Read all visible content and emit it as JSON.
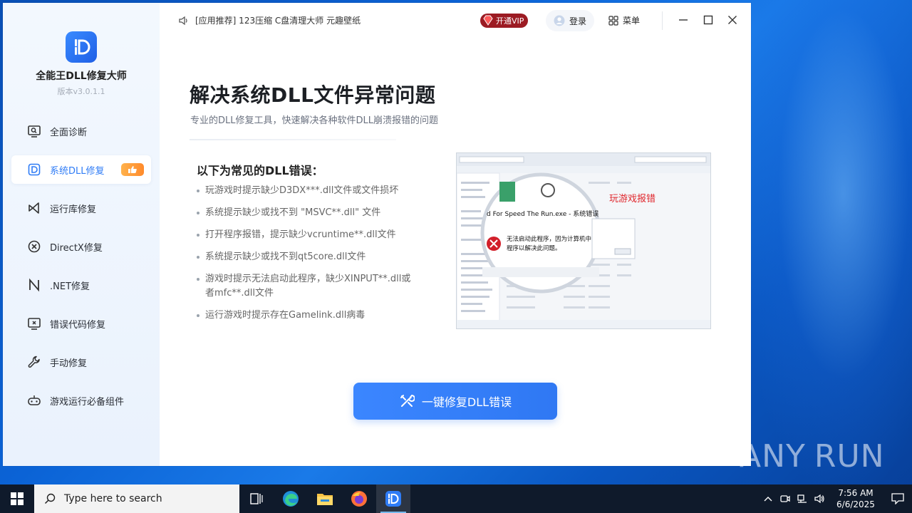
{
  "app": {
    "name": "全能王DLL修复大师",
    "version": "版本v3.0.1.1"
  },
  "nav": {
    "items": [
      {
        "label": "全面诊断"
      },
      {
        "label": "系统DLL修复",
        "active": true
      },
      {
        "label": "运行库修复"
      },
      {
        "label": "DirectX修复"
      },
      {
        "label": ".NET修复"
      },
      {
        "label": "错误代码修复"
      },
      {
        "label": "手动修复"
      },
      {
        "label": "游戏运行必备组件"
      }
    ]
  },
  "topbar": {
    "ticker": "[应用推荐] 123压缩 C盘清理大师 元趣壁纸",
    "vip": "开通VIP",
    "login": "登录",
    "menu": "菜单"
  },
  "main": {
    "headline": "解决系统DLL文件异常问题",
    "subhead": "专业的DLL修复工具，快速解决各种软件DLL崩溃报错的问题",
    "list_title": "以下为常见的DLL错误：",
    "errors": [
      "玩游戏时提示缺少D3DX***.dll文件或文件损坏",
      "系统提示缺少或找不到 \"MSVC**.dll\" 文件",
      "打开程序报错，提示缺少vcruntime**.dll文件",
      "系统提示缺少或找不到qt5core.dll文件",
      "游戏时提示无法启动此程序，缺少XINPUT**.dll或者mfc**.dll文件",
      "运行游戏时提示存在Gamelink.dll病毒"
    ],
    "screenshot": {
      "tag": "玩游戏报错",
      "dialog_title": "d For Speed The Run.exe - 系统错误",
      "dialog_text": "无法启动此程序，因为计算机中丢\n程序以解决此问题。"
    },
    "cta_label": "一键修复DLL错误"
  },
  "taskbar": {
    "search_placeholder": "Type here to search",
    "time": "7:56 AM",
    "date": "6/6/2025"
  },
  "watermark": "ANY RUN",
  "colors": {
    "accent": "#2f7cf6",
    "vip": "#9c1b23",
    "badge": "#ff8a2b"
  }
}
